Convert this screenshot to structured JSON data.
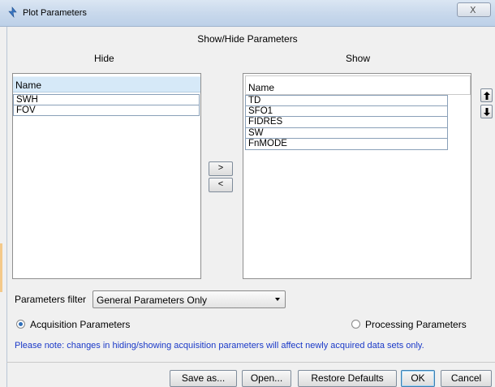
{
  "window": {
    "title": "Plot Parameters",
    "close_glyph": "X"
  },
  "header": {
    "title": "Show/Hide Parameters",
    "hide_label": "Hide",
    "show_label": "Show"
  },
  "hide_list": {
    "column_header": "Name",
    "items": [
      "SWH",
      "FOV"
    ]
  },
  "show_list": {
    "column_header": "Name",
    "items": [
      "TD",
      "SFO1",
      "FIDRES",
      "SW",
      "FnMODE"
    ]
  },
  "move_buttons": {
    "to_show": ">",
    "to_hide": "<"
  },
  "order_buttons": {
    "up_icon": "arrow-up-icon",
    "down_icon": "arrow-down-icon"
  },
  "filter": {
    "label": "Parameters filter",
    "selected": "General Parameters Only"
  },
  "radios": {
    "acquisition": {
      "label": "Acquisition Parameters",
      "checked": true
    },
    "processing": {
      "label": "Processing Parameters",
      "checked": false
    }
  },
  "note": "Please note: changes in hiding/showing acquisition parameters will affect newly acquired data sets only.",
  "buttons": {
    "save_as": "Save as...",
    "open": "Open...",
    "restore_defaults": "Restore Defaults",
    "ok": "OK",
    "cancel": "Cancel"
  },
  "colors": {
    "note_text": "#1a39c8",
    "header_highlight": "#d6e9f8",
    "radio_selected": "#2f6fb9"
  }
}
